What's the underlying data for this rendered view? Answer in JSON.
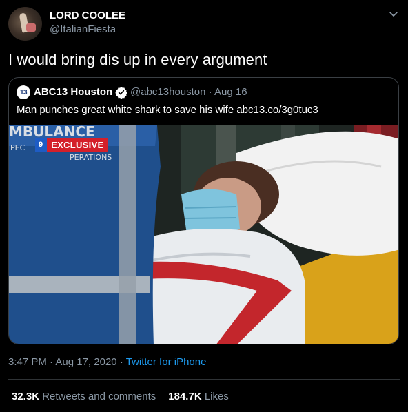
{
  "author": {
    "display_name": "LORD COOLEE",
    "handle": "@ItalianFiesta",
    "avatar_icon": "profile-photo"
  },
  "tweet": {
    "text": "I would bring dis up in every argument"
  },
  "quoted_tweet": {
    "avatar_label": "13",
    "display_name": "ABC13 Houston",
    "verified_icon": "verified-badge",
    "handle": "@abc13houston",
    "separator": "·",
    "date": "Aug 16",
    "text": "Man punches great white shark to save his wife abc13.co/3g0tuc3",
    "media": {
      "badge_logo": "9",
      "badge_text": "EXCLUSIVE",
      "background_text": "MBULANCE",
      "sub_text": "PEC",
      "ops_text": "PERATIONS"
    }
  },
  "meta": {
    "time": "3:47 PM",
    "dot": "·",
    "date": "Aug 17, 2020",
    "dot2": "·",
    "source": "Twitter for iPhone"
  },
  "stats": {
    "retweets_count": "32.3K",
    "retweets_label": "Retweets and comments",
    "likes_count": "184.7K",
    "likes_label": "Likes"
  },
  "colors": {
    "background": "#000000",
    "text": "#ffffff",
    "muted": "#8b98a5",
    "link": "#1d9bf0",
    "badge_red": "#d4202a"
  }
}
